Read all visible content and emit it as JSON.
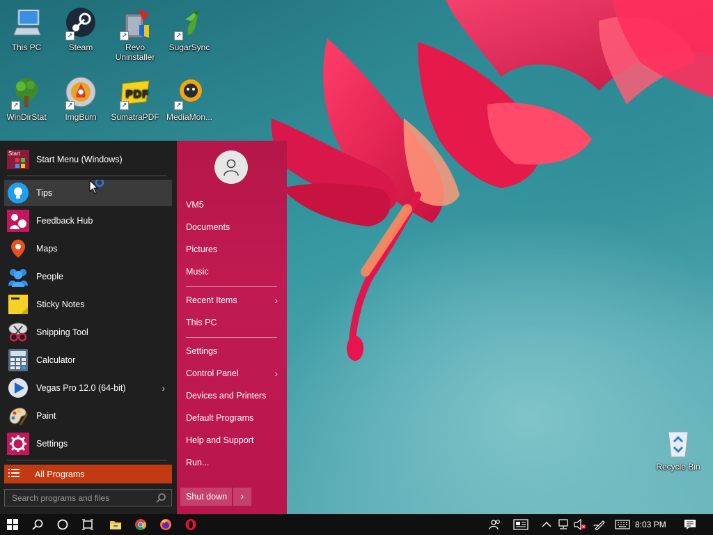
{
  "desktop": {
    "icons": [
      {
        "label": "This PC",
        "icon": "computer-icon"
      },
      {
        "label": "Steam",
        "icon": "steam-icon"
      },
      {
        "label": "Revo Uninstaller",
        "icon": "revo-uninstaller-icon"
      },
      {
        "label": "SugarSync",
        "icon": "sugarsync-icon"
      },
      {
        "label": "WinDirStat",
        "icon": "windirstat-icon"
      },
      {
        "label": "ImgBurn",
        "icon": "imgburn-icon"
      },
      {
        "label": "SumatraPDF",
        "icon": "sumatrapdf-icon"
      },
      {
        "label": "MediaMon...",
        "icon": "mediamonkey-icon"
      }
    ],
    "recycle_bin": {
      "label": "Recycle Bin",
      "icon": "recycle-bin-icon"
    }
  },
  "start_menu": {
    "header": {
      "label": "Start Menu (Windows)",
      "icon": "start-menu-logo-icon",
      "logo_text": "Start"
    },
    "apps": [
      {
        "label": "Tips",
        "icon": "tips-icon"
      },
      {
        "label": "Feedback Hub",
        "icon": "feedback-hub-icon"
      },
      {
        "label": "Maps",
        "icon": "maps-icon"
      },
      {
        "label": "People",
        "icon": "people-icon"
      },
      {
        "label": "Sticky Notes",
        "icon": "sticky-notes-icon"
      },
      {
        "label": "Snipping Tool",
        "icon": "snipping-tool-icon"
      },
      {
        "label": "Calculator",
        "icon": "calculator-icon"
      },
      {
        "label": "Vegas Pro 12.0 (64-bit)",
        "icon": "vegas-pro-icon",
        "has_submenu": true
      },
      {
        "label": "Paint",
        "icon": "paint-icon"
      },
      {
        "label": "Settings",
        "icon": "settings-gear-icon"
      }
    ],
    "all_programs": "All Programs",
    "search_placeholder": "Search programs and files",
    "right_pane": {
      "user": "VM5",
      "group1": [
        "Documents",
        "Pictures",
        "Music"
      ],
      "group2": [
        {
          "label": "Recent Items",
          "has_submenu": true
        },
        {
          "label": "This PC",
          "has_submenu": false
        }
      ],
      "group3": [
        {
          "label": "Settings",
          "has_submenu": false
        },
        {
          "label": "Control Panel",
          "has_submenu": true
        },
        {
          "label": "Devices and Printers",
          "has_submenu": false
        },
        {
          "label": "Default Programs",
          "has_submenu": false
        },
        {
          "label": "Help and Support",
          "has_submenu": false
        },
        {
          "label": "Run...",
          "has_submenu": false
        }
      ],
      "shutdown": "Shut down"
    }
  },
  "taskbar": {
    "pinned": [
      "windows-start-icon",
      "search-icon",
      "cortana-icon",
      "task-view-icon",
      "file-explorer-icon",
      "chrome-icon",
      "firefox-icon",
      "opera-icon"
    ],
    "tray": [
      "people-icon",
      "news-icon",
      "chevron-up-icon",
      "network-icon",
      "volume-muted-icon",
      "pen-icon",
      "keyboard-icon"
    ],
    "clock": "8:03 PM",
    "action_center": "action-center-icon"
  },
  "colors": {
    "accent_right_pane": "#b5174a",
    "all_programs_bg": "#c23a12",
    "left_pane_bg": "#1f1f1f",
    "taskbar_bg": "#101010"
  }
}
